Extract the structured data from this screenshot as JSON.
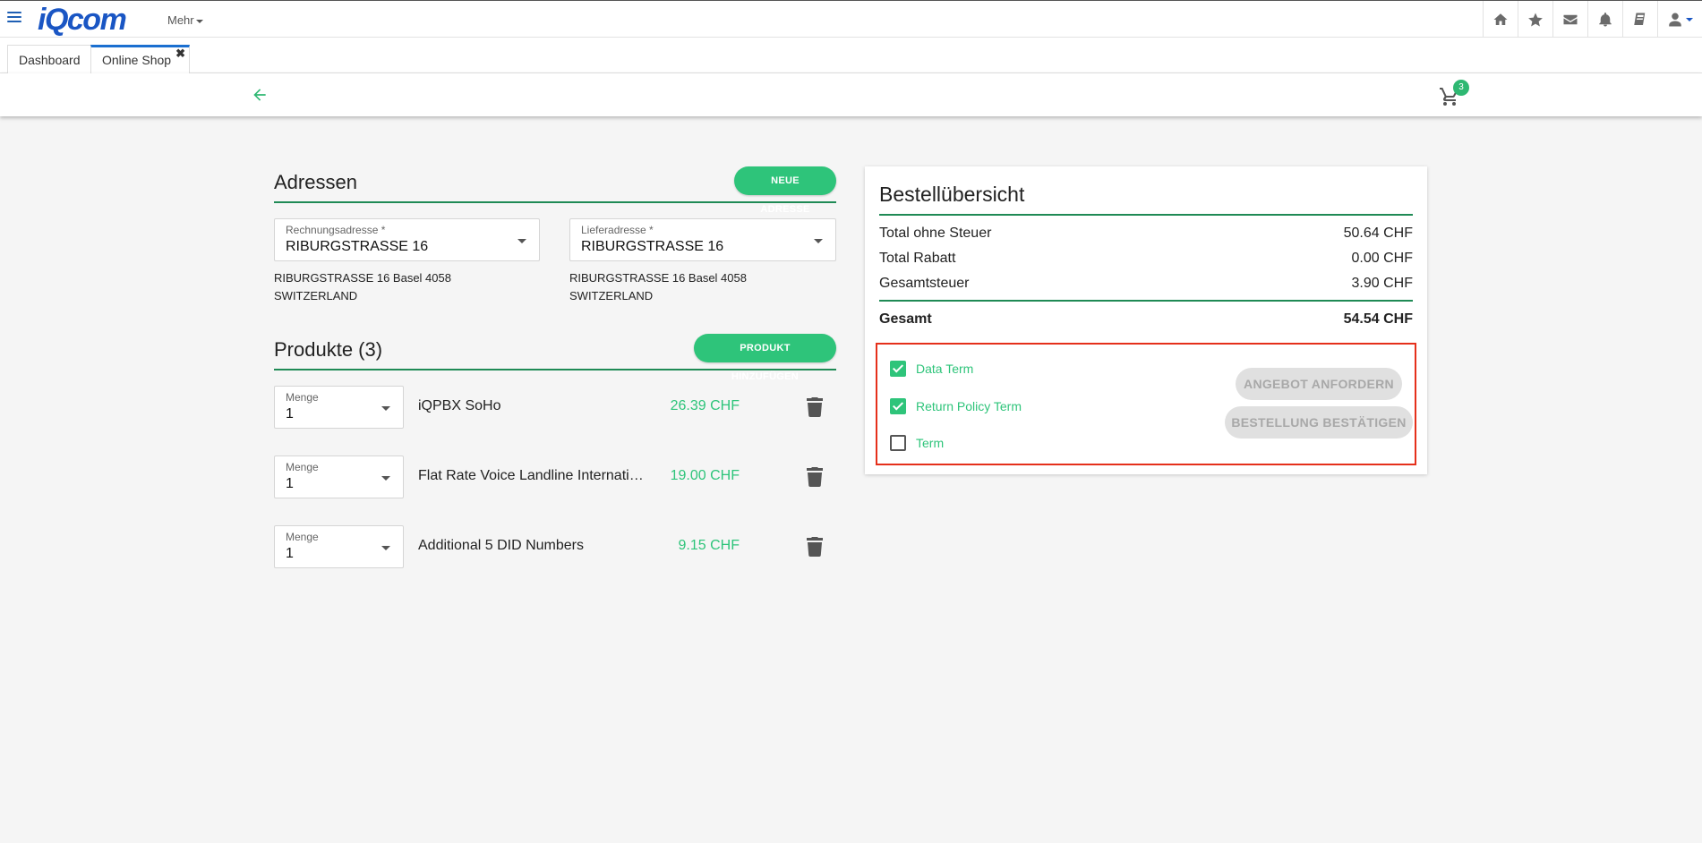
{
  "navbar": {
    "brand": "iQcom",
    "more_menu": "Mehr",
    "icons": [
      "home-icon",
      "star-icon",
      "mail-icon",
      "bell-icon",
      "book-icon",
      "user-icon"
    ]
  },
  "tabs": [
    {
      "label": "Dashboard"
    },
    {
      "label": "Online Shop",
      "close": "✖"
    }
  ],
  "toolbar": {
    "cart_count": "3"
  },
  "addresses": {
    "title": "Adressen",
    "new_button": "NEUE ADRESSE",
    "billing": {
      "label": "Rechnungsadresse *",
      "value": "RIBURGSTRASSE 16",
      "line1": "RIBURGSTRASSE 16 Basel 4058",
      "line2": "SWITZERLAND"
    },
    "shipping": {
      "label": "Lieferadresse *",
      "value": "RIBURGSTRASSE 16",
      "line1": "RIBURGSTRASSE 16 Basel 4058",
      "line2": "SWITZERLAND"
    }
  },
  "products": {
    "title": "Produkte (3)",
    "add_button": "PRODUKT HINZUFÜGEN",
    "qty_label": "Menge",
    "items": [
      {
        "qty": "1",
        "name": "iQPBX SoHo",
        "price": "26.39 CHF"
      },
      {
        "qty": "1",
        "name": "Flat Rate Voice Landline International",
        "price": "19.00 CHF"
      },
      {
        "qty": "1",
        "name": "Additional 5 DID Numbers",
        "price": "9.15 CHF"
      }
    ]
  },
  "summary": {
    "title": "Bestellübersicht",
    "rows": [
      {
        "label": "Total ohne Steuer",
        "value": "50.64 CHF"
      },
      {
        "label": "Total Rabatt",
        "value": "0.00 CHF"
      },
      {
        "label": "Gesamtsteuer",
        "value": "3.90 CHF"
      }
    ],
    "total": {
      "label": "Gesamt",
      "value": "54.54 CHF"
    },
    "terms": [
      {
        "label": "Data Term",
        "checked": true
      },
      {
        "label": "Return Policy Term",
        "checked": true
      },
      {
        "label": "Term",
        "checked": false
      }
    ],
    "quote_button": "ANGEBOT ANFORDERN",
    "confirm_button": "BESTELLUNG BESTÄTIGEN"
  },
  "colors": {
    "accent": "#2ec47a",
    "brand": "#1a56c4",
    "highlight_border": "#e5301b"
  }
}
